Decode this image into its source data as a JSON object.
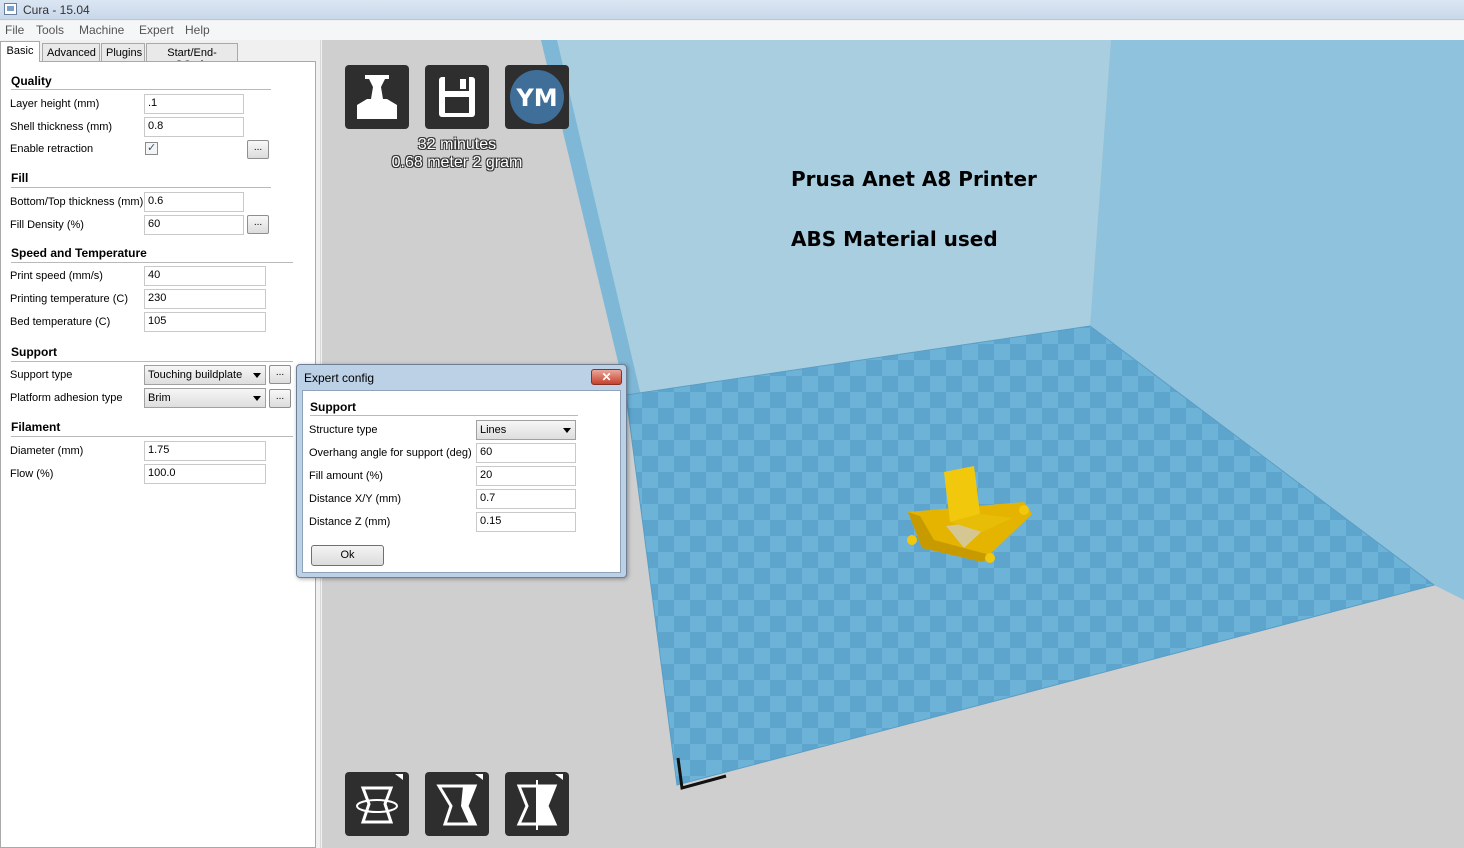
{
  "window": {
    "title": "Cura - 15.04"
  },
  "menu": [
    "File",
    "Tools",
    "Machine",
    "Expert",
    "Help"
  ],
  "tabs": [
    "Basic",
    "Advanced",
    "Plugins",
    "Start/End-GCode"
  ],
  "quality": {
    "title": "Quality",
    "layer_height_label": "Layer height (mm)",
    "layer_height": ".1",
    "shell_label": "Shell thickness (mm)",
    "shell": "0.8",
    "retraction_label": "Enable retraction",
    "retraction_checked": true
  },
  "fill": {
    "title": "Fill",
    "bottom_top_label": "Bottom/Top thickness (mm)",
    "bottom_top": "0.6",
    "density_label": "Fill Density (%)",
    "density": "60"
  },
  "speed": {
    "title": "Speed and Temperature",
    "print_speed_label": "Print speed (mm/s)",
    "print_speed": "40",
    "print_temp_label": "Printing temperature (C)",
    "print_temp": "230",
    "bed_temp_label": "Bed temperature (C)",
    "bed_temp": "105"
  },
  "support": {
    "title": "Support",
    "type_label": "Support type",
    "type": "Touching buildplate",
    "adhesion_label": "Platform adhesion type",
    "adhesion": "Brim"
  },
  "filament": {
    "title": "Filament",
    "diameter_label": "Diameter (mm)",
    "diameter": "1.75",
    "flow_label": "Flow (%)",
    "flow": "100.0"
  },
  "common": {
    "ellipsis": "..."
  },
  "print_info": {
    "time": "32 minutes",
    "material": "0.68 meter 2 gram"
  },
  "toolbar": {
    "ym_label": "YM"
  },
  "overlay": {
    "line1": "Prusa Anet A8 Printer",
    "line2": "ABS Material used"
  },
  "dialog": {
    "title": "Expert config",
    "close": "✕",
    "section": "Support",
    "structure_label": "Structure type",
    "structure": "Lines",
    "overhang_label": "Overhang angle for support (deg)",
    "overhang": "60",
    "fill_label": "Fill amount (%)",
    "fill": "20",
    "dist_xy_label": "Distance X/Y (mm)",
    "dist_xy": "0.7",
    "dist_z_label": "Distance Z (mm)",
    "dist_z": "0.15",
    "ok": "Ok"
  },
  "icons": [
    "load-icon",
    "save-icon",
    "youmagine-icon",
    "rotate-icon",
    "scale-icon",
    "mirror-icon"
  ],
  "colors": {
    "bed": "#6db3d8",
    "wall": "#a6cde0",
    "model": "#f2c80c",
    "button": "#2e2e2e",
    "ym": "#3f6f99"
  }
}
